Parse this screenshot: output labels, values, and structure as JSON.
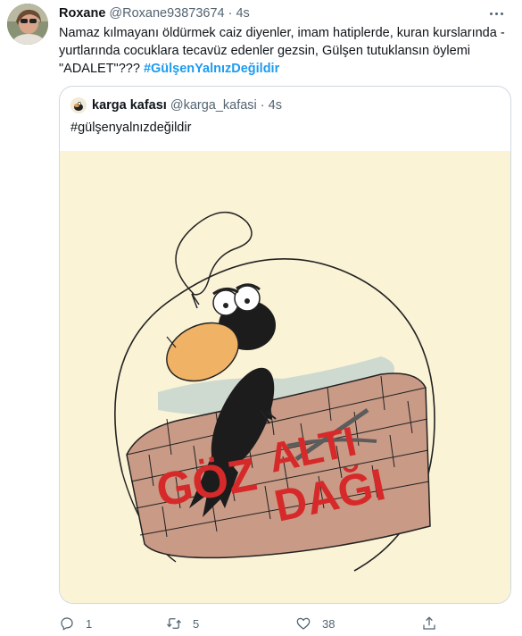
{
  "tweet": {
    "author_name": "Roxane",
    "author_handle": "@Roxane93873674",
    "separator": "·",
    "time": "4s",
    "text": "Namaz kılmayanı öldürmek caiz diyenler,  imam hatiplerde,  kuran kurslarında - yurtlarında cocuklara tecavüz edenler gezsin, Gülşen tutuklansın öylemi \"ADALET\"??? ",
    "hashtag": "#GülşenYalnızDeğildir"
  },
  "quoted": {
    "author_name": "karga kafası",
    "author_handle": "@karga_kafasi",
    "separator": "·",
    "time": "4s",
    "text": "#gülşenyalnızdeğildir",
    "image_text": {
      "word1": "GÖZ",
      "word2": "ALTI",
      "word3": "DAĞI"
    }
  },
  "actions": {
    "reply_count": "1",
    "retweet_count": "5",
    "like_count": "38"
  },
  "icons": [
    "more-icon",
    "reply-icon",
    "retweet-icon",
    "like-icon",
    "share-icon"
  ],
  "colors": {
    "text": "#0f1419",
    "secondary": "#536471",
    "link": "#1d9bf0",
    "border": "#cfd9de",
    "media_bg": "#fbf3d6",
    "graffiti_red": "#d62a2a"
  }
}
